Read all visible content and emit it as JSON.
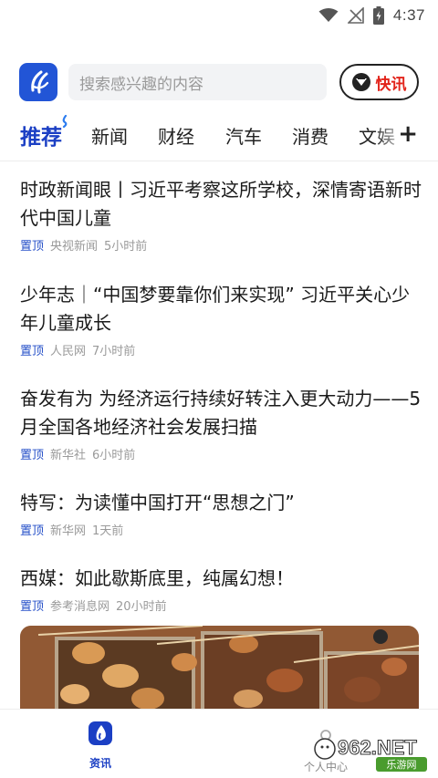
{
  "status_bar": {
    "time": "4:37",
    "icons": [
      "wifi-icon",
      "no-signal-icon",
      "battery-charging-icon"
    ]
  },
  "header": {
    "logo_icon": "app-logo-icon",
    "search": {
      "placeholder": "搜索感兴趣的内容"
    },
    "kuaixun": {
      "label": "快讯",
      "icon": "kuaixun-icon"
    }
  },
  "tabs": {
    "items": [
      {
        "label": "推荐",
        "active": true
      },
      {
        "label": "新闻"
      },
      {
        "label": "财经"
      },
      {
        "label": "汽车"
      },
      {
        "label": "消费"
      },
      {
        "label": "文娱"
      }
    ],
    "add_icon": "plus-icon"
  },
  "feed": {
    "items": [
      {
        "title": "时政新闻眼丨习近平考察这所学校，深情寄语新时代中国儿童",
        "tag": "置顶",
        "source": "央视新闻",
        "time": "5小时前"
      },
      {
        "title": "少年志｜“中国梦要靠你们来实现” 习近平关心少年儿童成长",
        "tag": "置顶",
        "source": "人民网",
        "time": "7小时前"
      },
      {
        "title": "奋发有为 为经济运行持续好转注入更大动力——5月全国各地经济社会发展扫描",
        "tag": "置顶",
        "source": "新华社",
        "time": "6小时前"
      },
      {
        "title": "特写：为读懂中国打开“思想之门”",
        "tag": "置顶",
        "source": "新华网",
        "time": "1天前"
      },
      {
        "title": "西媒：如此歇斯底里，纯属幻想！",
        "tag": "置顶",
        "source": "参考消息网",
        "time": "20小时前"
      }
    ]
  },
  "bottom_nav": {
    "items": [
      {
        "label": "资讯",
        "icon": "news-icon",
        "active": true
      },
      {
        "label": "个人中心",
        "icon": "profile-icon"
      }
    ]
  },
  "watermark": {
    "text": "962.NET",
    "subtext": "乐游网"
  },
  "colors": {
    "brand_blue": "#1b3fc4",
    "accent_red": "#e2231a",
    "meta_gray": "#9a9a9a"
  }
}
